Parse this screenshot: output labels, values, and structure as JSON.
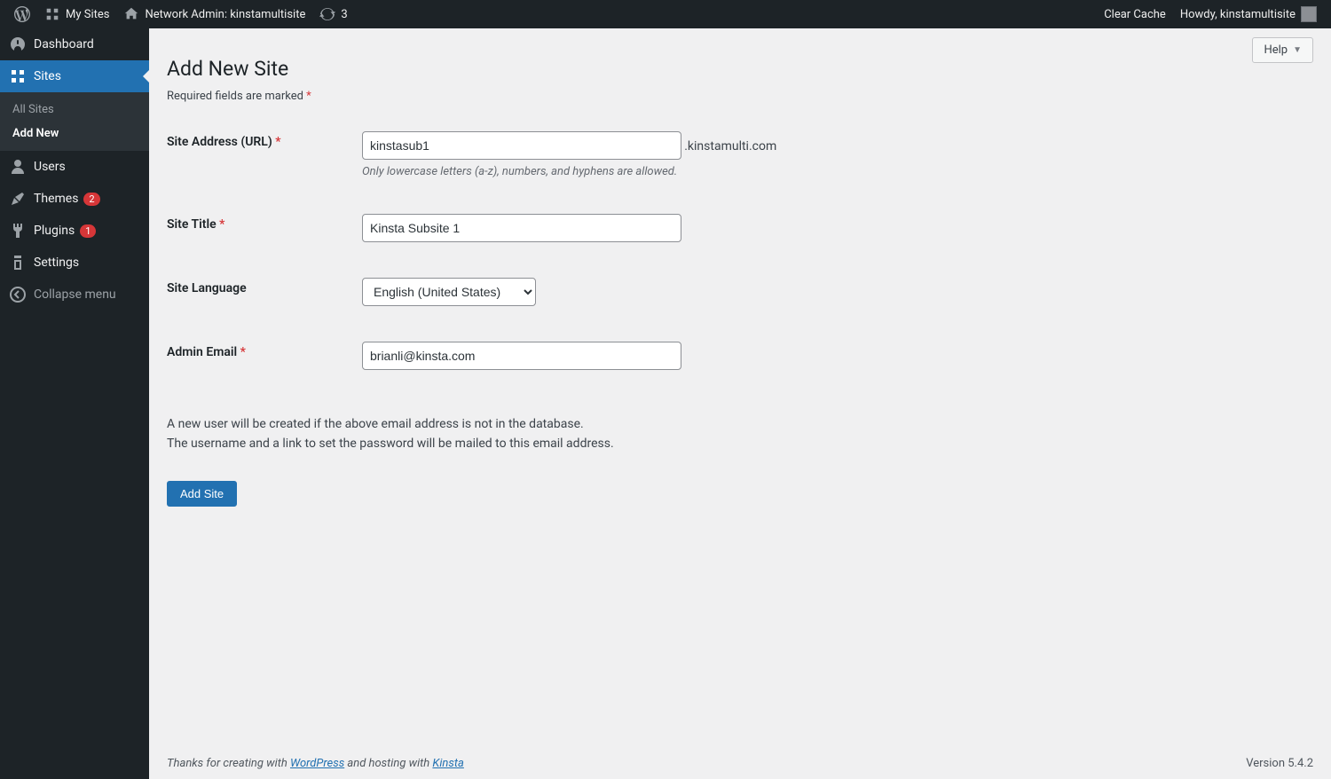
{
  "adminbar": {
    "mysites": "My Sites",
    "network_admin": "Network Admin: kinstamultisite",
    "pending_count": "3",
    "clear_cache": "Clear Cache",
    "howdy": "Howdy, kinstamultisite"
  },
  "sidebar": {
    "dashboard": "Dashboard",
    "sites": "Sites",
    "all_sites": "All Sites",
    "add_new": "Add New",
    "users": "Users",
    "themes": "Themes",
    "themes_badge": "2",
    "plugins": "Plugins",
    "plugins_badge": "1",
    "settings": "Settings",
    "collapse": "Collapse menu"
  },
  "page": {
    "help": "Help",
    "title": "Add New Site",
    "required_note": "Required fields are marked ",
    "site_address_label": "Site Address (URL) ",
    "site_address_value": "kinstasub1",
    "site_address_suffix": ".kinstamulti.com",
    "site_address_hint": "Only lowercase letters (a-z), numbers, and hyphens are allowed.",
    "site_title_label": "Site Title ",
    "site_title_value": "Kinsta Subsite 1",
    "site_language_label": "Site Language",
    "site_language_value": "English (United States)",
    "admin_email_label": "Admin Email ",
    "admin_email_value": "brianli@kinsta.com",
    "note_line1": "A new user will be created if the above email address is not in the database.",
    "note_line2": "The username and a link to set the password will be mailed to this email address.",
    "submit": "Add Site"
  },
  "footer": {
    "thanks_pre": "Thanks for creating with ",
    "wordpress": "WordPress",
    "thanks_mid": " and hosting with ",
    "kinsta": "Kinsta",
    "version": "Version 5.4.2"
  }
}
